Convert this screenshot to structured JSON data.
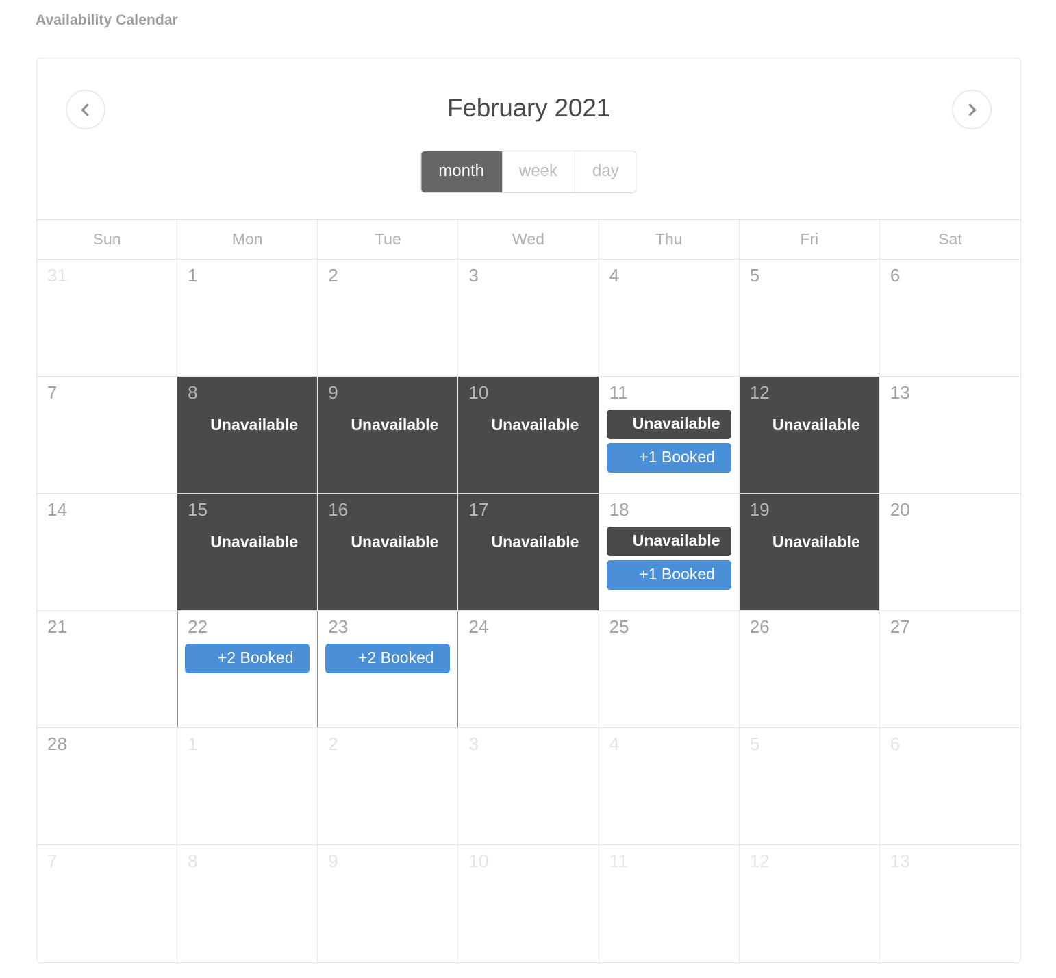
{
  "section": {
    "title": "Availability Calendar"
  },
  "toolbar": {
    "prev_label": "‹",
    "next_label": "›",
    "title": "February 2021",
    "views": [
      {
        "id": "month",
        "label": "month",
        "active": true
      },
      {
        "id": "week",
        "label": "week",
        "active": false
      },
      {
        "id": "day",
        "label": "day",
        "active": false
      }
    ]
  },
  "weekdays": [
    "Sun",
    "Mon",
    "Tue",
    "Wed",
    "Thu",
    "Fri",
    "Sat"
  ],
  "colors": {
    "blocked": "#4a4a4a",
    "booked": "#4a90d9",
    "active_view": "#666666",
    "grid_line": "#e2e2e2",
    "day_number": "#a3a3a3",
    "other_month_day": "#e4e4e4"
  },
  "weeks": [
    [
      {
        "num": "31",
        "other": true,
        "state": "free",
        "events": []
      },
      {
        "num": "1",
        "other": false,
        "state": "free",
        "events": []
      },
      {
        "num": "2",
        "other": false,
        "state": "free",
        "events": []
      },
      {
        "num": "3",
        "other": false,
        "state": "free",
        "events": []
      },
      {
        "num": "4",
        "other": false,
        "state": "free",
        "events": []
      },
      {
        "num": "5",
        "other": false,
        "state": "free",
        "events": []
      },
      {
        "num": "6",
        "other": false,
        "state": "free",
        "events": []
      }
    ],
    [
      {
        "num": "7",
        "other": false,
        "state": "free",
        "events": []
      },
      {
        "num": "8",
        "other": false,
        "state": "blocked",
        "block_label": "Unavailable",
        "events": []
      },
      {
        "num": "9",
        "other": false,
        "state": "blocked",
        "block_label": "Unavailable",
        "events": []
      },
      {
        "num": "10",
        "other": false,
        "state": "blocked",
        "block_label": "Unavailable",
        "events": []
      },
      {
        "num": "11",
        "other": false,
        "state": "chips",
        "events": [
          {
            "type": "unavailable",
            "label": "Unavailable"
          },
          {
            "type": "booked",
            "label": "+1 Booked"
          }
        ]
      },
      {
        "num": "12",
        "other": false,
        "state": "blocked",
        "block_label": "Unavailable",
        "events": []
      },
      {
        "num": "13",
        "other": false,
        "state": "free",
        "events": []
      }
    ],
    [
      {
        "num": "14",
        "other": false,
        "state": "free",
        "events": []
      },
      {
        "num": "15",
        "other": false,
        "state": "blocked",
        "block_label": "Unavailable",
        "events": []
      },
      {
        "num": "16",
        "other": false,
        "state": "blocked",
        "block_label": "Unavailable",
        "events": []
      },
      {
        "num": "17",
        "other": false,
        "state": "blocked",
        "block_label": "Unavailable",
        "events": []
      },
      {
        "num": "18",
        "other": false,
        "state": "chips",
        "events": [
          {
            "type": "unavailable",
            "label": "Unavailable"
          },
          {
            "type": "booked",
            "label": "+1 Booked"
          }
        ]
      },
      {
        "num": "19",
        "other": false,
        "state": "blocked",
        "block_label": "Unavailable",
        "events": []
      },
      {
        "num": "20",
        "other": false,
        "state": "free",
        "events": []
      }
    ],
    [
      {
        "num": "21",
        "other": false,
        "state": "free",
        "events": []
      },
      {
        "num": "22",
        "other": false,
        "state": "chips",
        "sep": "both",
        "events": [
          {
            "type": "booked",
            "label": "+2 Booked"
          }
        ]
      },
      {
        "num": "23",
        "other": false,
        "state": "chips",
        "sep": "right",
        "events": [
          {
            "type": "booked",
            "label": "+2 Booked"
          }
        ]
      },
      {
        "num": "24",
        "other": false,
        "state": "free",
        "events": []
      },
      {
        "num": "25",
        "other": false,
        "state": "free",
        "events": []
      },
      {
        "num": "26",
        "other": false,
        "state": "free",
        "events": []
      },
      {
        "num": "27",
        "other": false,
        "state": "free",
        "events": []
      }
    ],
    [
      {
        "num": "28",
        "other": false,
        "state": "free",
        "events": []
      },
      {
        "num": "1",
        "other": true,
        "state": "free",
        "events": []
      },
      {
        "num": "2",
        "other": true,
        "state": "free",
        "events": []
      },
      {
        "num": "3",
        "other": true,
        "state": "free",
        "events": []
      },
      {
        "num": "4",
        "other": true,
        "state": "free",
        "events": []
      },
      {
        "num": "5",
        "other": true,
        "state": "free",
        "events": []
      },
      {
        "num": "6",
        "other": true,
        "state": "free",
        "events": []
      }
    ],
    [
      {
        "num": "7",
        "other": true,
        "state": "free",
        "events": []
      },
      {
        "num": "8",
        "other": true,
        "state": "free",
        "events": []
      },
      {
        "num": "9",
        "other": true,
        "state": "free",
        "events": []
      },
      {
        "num": "10",
        "other": true,
        "state": "free",
        "events": []
      },
      {
        "num": "11",
        "other": true,
        "state": "free",
        "events": []
      },
      {
        "num": "12",
        "other": true,
        "state": "free",
        "events": []
      },
      {
        "num": "13",
        "other": true,
        "state": "free",
        "events": []
      }
    ]
  ]
}
